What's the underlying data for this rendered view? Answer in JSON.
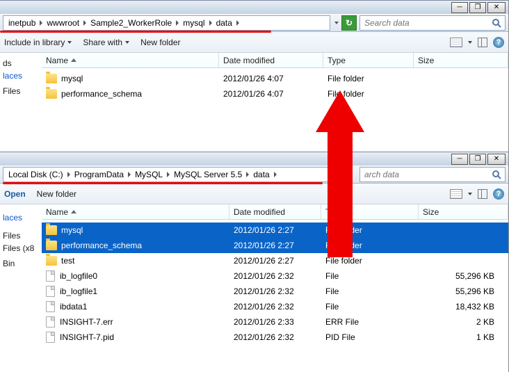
{
  "win1": {
    "crumbs": [
      "inetpub",
      "wwwroot",
      "Sample2_WorkerRole",
      "mysql",
      "data"
    ],
    "search_placeholder": "Search data",
    "toolbar": {
      "include": "Include in library",
      "share": "Share with",
      "newfolder": "New folder"
    },
    "headers": {
      "name": "Name",
      "date": "Date modified",
      "type": "Type",
      "size": "Size"
    },
    "rows": [
      {
        "icon": "folder",
        "name": "mysql",
        "date": "2012/01/26 4:07",
        "type": "File folder",
        "size": ""
      },
      {
        "icon": "folder",
        "name": "performance_schema",
        "date": "2012/01/26 4:07",
        "type": "File folder",
        "size": ""
      }
    ],
    "side": [
      "ds",
      "laces",
      "",
      "Files"
    ]
  },
  "win2": {
    "crumbs": [
      "Local Disk (C:)",
      "ProgramData",
      "MySQL",
      "MySQL Server 5.5",
      "data"
    ],
    "search_placeholder": "arch data",
    "toolbar": {
      "open": "Open",
      "newfolder": "New folder"
    },
    "headers": {
      "name": "Name",
      "date": "Date modified",
      "type": "Type",
      "size": "Size"
    },
    "rows": [
      {
        "icon": "folder",
        "name": "mysql",
        "date": "2012/01/26 2:27",
        "type": "File folder",
        "size": "",
        "sel": true
      },
      {
        "icon": "folder",
        "name": "performance_schema",
        "date": "2012/01/26 2:27",
        "type": "File folder",
        "size": "",
        "sel": true
      },
      {
        "icon": "folder",
        "name": "test",
        "date": "2012/01/26 2:27",
        "type": "File folder",
        "size": ""
      },
      {
        "icon": "file",
        "name": "ib_logfile0",
        "date": "2012/01/26 2:32",
        "type": "File",
        "size": "55,296 KB"
      },
      {
        "icon": "file",
        "name": "ib_logfile1",
        "date": "2012/01/26 2:32",
        "type": "File",
        "size": "55,296 KB"
      },
      {
        "icon": "file",
        "name": "ibdata1",
        "date": "2012/01/26 2:32",
        "type": "File",
        "size": "18,432 KB"
      },
      {
        "icon": "file",
        "name": "INSIGHT-7.err",
        "date": "2012/01/26 2:33",
        "type": "ERR File",
        "size": "2 KB"
      },
      {
        "icon": "file",
        "name": "INSIGHT-7.pid",
        "date": "2012/01/26 2:32",
        "type": "PID File",
        "size": "1 KB"
      }
    ],
    "side": [
      "",
      "laces",
      "",
      "",
      "Files",
      "Files (x8",
      "",
      "Bin"
    ]
  }
}
